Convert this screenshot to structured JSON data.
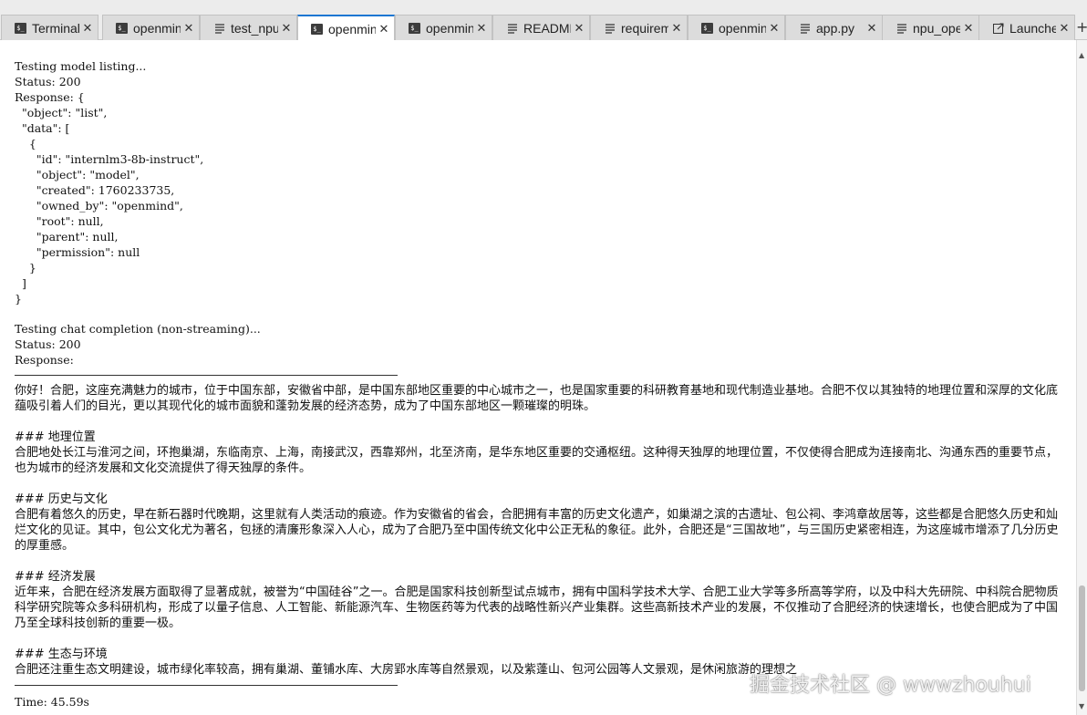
{
  "tabs": [
    {
      "label": "Terminal",
      "icon": "terminal-icon",
      "active": false
    },
    {
      "label": "openmind",
      "icon": "terminal-icon",
      "active": false
    },
    {
      "label": "test_npu",
      "icon": "text-file-icon",
      "active": false
    },
    {
      "label": "openmind",
      "icon": "terminal-icon",
      "active": true
    },
    {
      "label": "openmind",
      "icon": "terminal-icon",
      "active": false
    },
    {
      "label": "README",
      "icon": "text-file-icon",
      "active": false
    },
    {
      "label": "requirements",
      "icon": "text-file-icon",
      "active": false
    },
    {
      "label": "openmind",
      "icon": "terminal-icon",
      "active": false
    },
    {
      "label": "app.py",
      "icon": "text-file-icon",
      "active": false
    },
    {
      "label": "npu_ope",
      "icon": "text-file-icon",
      "active": false
    },
    {
      "label": "Launcher",
      "icon": "launcher-icon",
      "active": false
    }
  ],
  "add_tab_label": "+",
  "terminal": {
    "model_listing": "Testing model listing...\nStatus: 200\nResponse: {\n  \"object\": \"list\",\n  \"data\": [\n    {\n      \"id\": \"internlm3-8b-instruct\",\n      \"object\": \"model\",\n      \"created\": 1760233735,\n      \"owned_by\": \"openmind\",\n      \"root\": null,\n      \"parent\": null,\n      \"permission\": null\n    }\n  ]\n}",
    "chat_status": "Testing chat completion (non-streaming)...\nStatus: 200\nResponse:",
    "intro": "你好！合肥，这座充满魅力的城市，位于中国东部，安徽省中部，是中国东部地区重要的中心城市之一，也是国家重要的科研教育基地和现代制造业基地。合肥不仅以其独特的地理位置和深厚的文化底蕴吸引着人们的目光，更以其现代化的城市面貌和蓬勃发展的经济态势，成为了中国东部地区一颗璀璨的明珠。",
    "sections": [
      {
        "heading": "### 地理位置",
        "body": "合肥地处长江与淮河之间，环抱巢湖，东临南京、上海，南接武汉，西靠郑州，北至济南，是华东地区重要的交通枢纽。这种得天独厚的地理位置，不仅使得合肥成为连接南北、沟通东西的重要节点，也为城市的经济发展和文化交流提供了得天独厚的条件。"
      },
      {
        "heading": "### 历史与文化",
        "body": "合肥有着悠久的历史，早在新石器时代晚期，这里就有人类活动的痕迹。作为安徽省的省会，合肥拥有丰富的历史文化遗产，如巢湖之滨的古遗址、包公祠、李鸿章故居等，这些都是合肥悠久历史和灿烂文化的见证。其中，包公文化尤为著名，包拯的清廉形象深入人心，成为了合肥乃至中国传统文化中公正无私的象征。此外，合肥还是“三国故地”，与三国历史紧密相连，为这座城市增添了几分历史的厚重感。"
      },
      {
        "heading": "### 经济发展",
        "body": "近年来，合肥在经济发展方面取得了显著成就，被誉为“中国硅谷”之一。合肥是国家科技创新型试点城市，拥有中国科学技术大学、合肥工业大学等多所高等学府，以及中科大先研院、中科院合肥物质科学研究院等众多科研机构，形成了以量子信息、人工智能、新能源汽车、生物医药等为代表的战略性新兴产业集群。这些高新技术产业的发展，不仅推动了合肥经济的快速增长，也使合肥成为了中国乃至全球科技创新的重要一极。"
      },
      {
        "heading": "### 生态与环境",
        "body": "合肥还注重生态文明建设，城市绿化率较高，拥有巢湖、董铺水库、大房郢水库等自然景观，以及紫蓬山、包河公园等人文景观，是休闲旅游的理想之"
      }
    ],
    "time": "Time: 45.59s"
  },
  "watermark": "掘金技术社区 @ wwwzhouhui",
  "colors": {
    "active_tab_accent": "#1976d2",
    "tabbar_bg": "#ececec",
    "terminal_bg": "#ffffff"
  }
}
